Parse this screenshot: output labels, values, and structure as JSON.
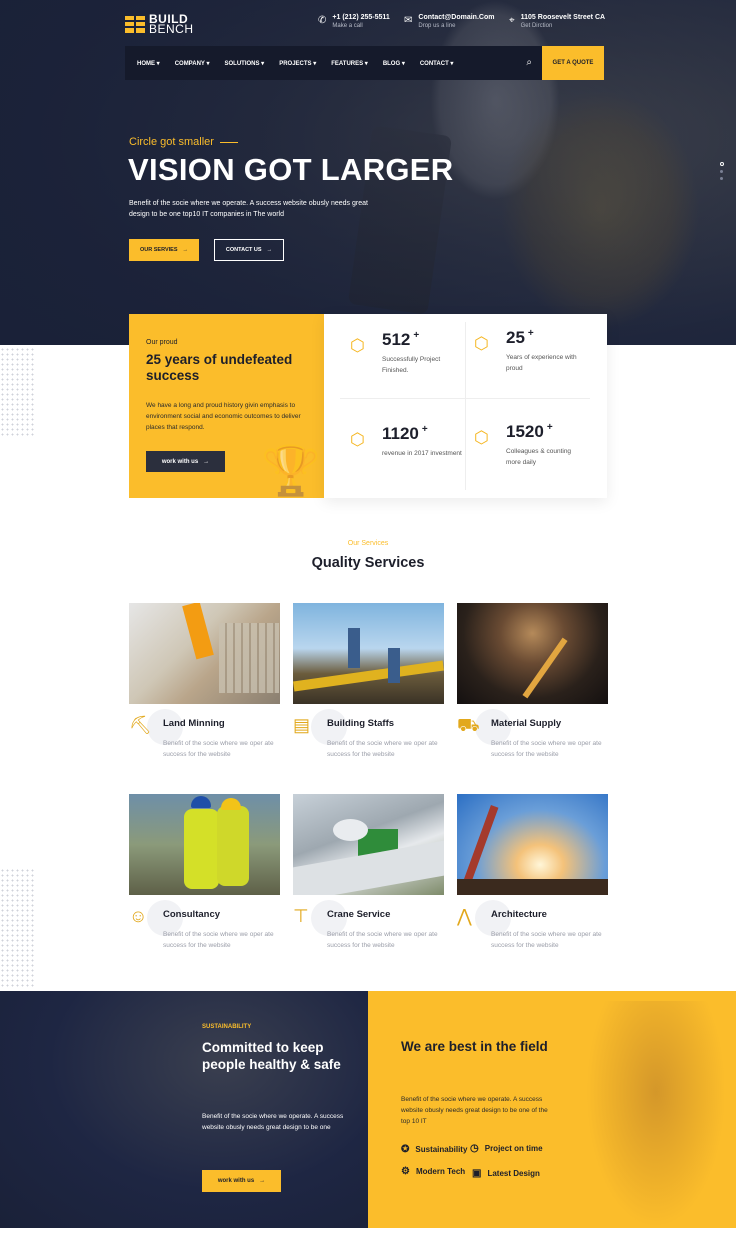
{
  "brand": {
    "name_line1": "BUILD",
    "name_line2": "BENCH"
  },
  "contacts": [
    {
      "icon": "phone-icon",
      "title": "+1 (212) 255-5511",
      "sub": "Make a call"
    },
    {
      "icon": "mail-icon",
      "title": "Contact@Domain.Com",
      "sub": "Drop us a line"
    },
    {
      "icon": "location-icon",
      "title": "1105 Roosevelt Street CA",
      "sub": "Get Dirction"
    }
  ],
  "nav": {
    "items": [
      "HOME",
      "COMPANY",
      "SOLUTIONS",
      "PROJECTS",
      "FEATURES",
      "BLOG",
      "CONTACT"
    ],
    "quote_label": "GET A QUOTE"
  },
  "hero": {
    "subtitle": "Circle got smaller",
    "title": "VISION GOT LARGER",
    "description": "Benefit of the socie where we operate. A success website obusly needs great design to be one top10 IT companies in The world",
    "primary_btn": "OUR SERVIES",
    "secondary_btn": "CONTACT US"
  },
  "proud": {
    "caption": "Our proud",
    "title": "25 years of undefeated success",
    "description": "We have a long and proud history givin emphasis to environment social and economic outcomes to deliver places that respond.",
    "button": "work with us"
  },
  "stats": [
    {
      "value": "512",
      "label": "Successfully Project Finished."
    },
    {
      "value": "25",
      "label": "Years of experience with proud"
    },
    {
      "value": "1120",
      "label": "revenue in 2017 investment"
    },
    {
      "value": "1520",
      "label": "Colleagues & counting more daily"
    }
  ],
  "services_section": {
    "subtitle": "Our Services",
    "title": "Quality Services"
  },
  "services": [
    {
      "name": "Land Minning",
      "desc": "Benefit of the socie where we oper ate success for the website",
      "icon": "drill-icon"
    },
    {
      "name": "Building Staffs",
      "desc": "Benefit of the socie where we oper ate success for the website",
      "icon": "building-icon"
    },
    {
      "name": "Material Supply",
      "desc": "Benefit of the socie where we oper ate success for the website",
      "icon": "truck-icon"
    },
    {
      "name": "Consultancy",
      "desc": "Benefit of the socie where we oper ate success for the website",
      "icon": "worker-icon"
    },
    {
      "name": "Crane Service",
      "desc": "Benefit of the socie where we oper ate success for the website",
      "icon": "crane-icon"
    },
    {
      "name": "Architecture",
      "desc": "Benefit of the socie where we oper ate success for the website",
      "icon": "tripod-icon"
    }
  ],
  "sustain": {
    "caption": "SUSTAINABILITY",
    "title": "Committed to keep people healthy & safe",
    "description": "Benefit of the socie where we operate. A success website obusly needs great design to be one",
    "button": "work with us"
  },
  "best": {
    "title": "We are best in the field",
    "description": "Benefit of the socie where we operate. A success website obusly needs great design to be one of the top 10 IT",
    "features": [
      "Sustainability",
      "Project on time",
      "Modern Tech",
      "Latest Design"
    ]
  },
  "colors": {
    "accent": "#fbbd2b",
    "dark": "#1a2138"
  }
}
